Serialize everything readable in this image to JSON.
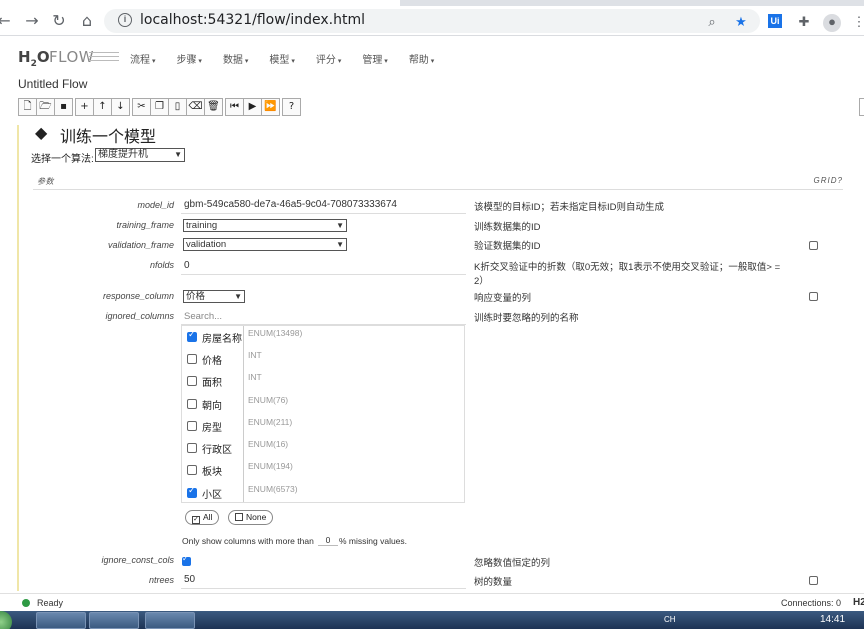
{
  "browser": {
    "url": "localhost:54321/flow/index.html",
    "ext_label": "Ui"
  },
  "header": {
    "logo_h2o": "H",
    "logo_sub": "2",
    "logo_o": "O",
    "logo_flow": "FLOW",
    "menu": [
      "流程",
      "步骤",
      "数据",
      "模型",
      "评分",
      "管理",
      "帮助"
    ],
    "flow_title": "Untitled Flow"
  },
  "toolbar_icons": [
    [
      "new-file-icon",
      "open-folder-icon",
      "save-icon"
    ],
    [
      "insert-cell-icon",
      "move-up-icon",
      "move-down-icon"
    ],
    [
      "cut-icon",
      "copy-icon",
      "paste-icon",
      "clear-icon",
      "delete-icon"
    ],
    [
      "run-step-icon",
      "run-icon",
      "run-all-icon"
    ],
    [
      "help-icon"
    ]
  ],
  "cell": {
    "title": "训练一个模型",
    "algo_label": "选择一个算法:",
    "algo_value": "梯度提升机",
    "params_label": "参数",
    "grid_label": "GRID?"
  },
  "params": {
    "model_id": {
      "label": "model_id",
      "value": "gbm-549ca580-de7a-46a5-9c04-708073333674",
      "help": "该模型的目标ID；若未指定目标ID则自动生成"
    },
    "training_frame": {
      "label": "training_frame",
      "value": "training",
      "help": "训练数据集的ID"
    },
    "validation_frame": {
      "label": "validation_frame",
      "value": "validation",
      "help": "验证数据集的ID"
    },
    "nfolds": {
      "label": "nfolds",
      "value": "0",
      "help": "K折交叉验证中的折数（取0无效；取1表示不使用交叉验证；一般取值> =",
      "help2": "2）"
    },
    "response_column": {
      "label": "response_column",
      "value": "价格",
      "help": "响应变量的列"
    },
    "ignored_columns": {
      "label": "ignored_columns",
      "placeholder": "Search...",
      "help": "训练时要忽略的列的名称"
    },
    "ignore_const_cols": {
      "label": "ignore_const_cols",
      "help": "忽略数值恒定的列"
    },
    "ntrees": {
      "label": "ntrees",
      "value": "50",
      "help": "树的数量"
    }
  },
  "columns": [
    {
      "name": "房屋名称",
      "type": "ENUM(13498)",
      "checked": true
    },
    {
      "name": "价格",
      "type": "INT",
      "checked": false
    },
    {
      "name": "面积",
      "type": "INT",
      "checked": false
    },
    {
      "name": "朝向",
      "type": "ENUM(76)",
      "checked": false
    },
    {
      "name": "房型",
      "type": "ENUM(211)",
      "checked": false
    },
    {
      "name": "行政区",
      "type": "ENUM(16)",
      "checked": false
    },
    {
      "name": "板块",
      "type": "ENUM(194)",
      "checked": false
    },
    {
      "name": "小区",
      "type": "ENUM(6573)",
      "checked": true
    }
  ],
  "col_buttons": {
    "all": "All",
    "none": "None"
  },
  "missing": {
    "before": "Only show columns with more than",
    "value": "0",
    "after": "% missing values."
  },
  "status": {
    "text": "Ready",
    "connections": "Connections:  0",
    "mini_logo": "H2"
  },
  "taskbar": {
    "clock": "14:41",
    "tray": "CH"
  }
}
